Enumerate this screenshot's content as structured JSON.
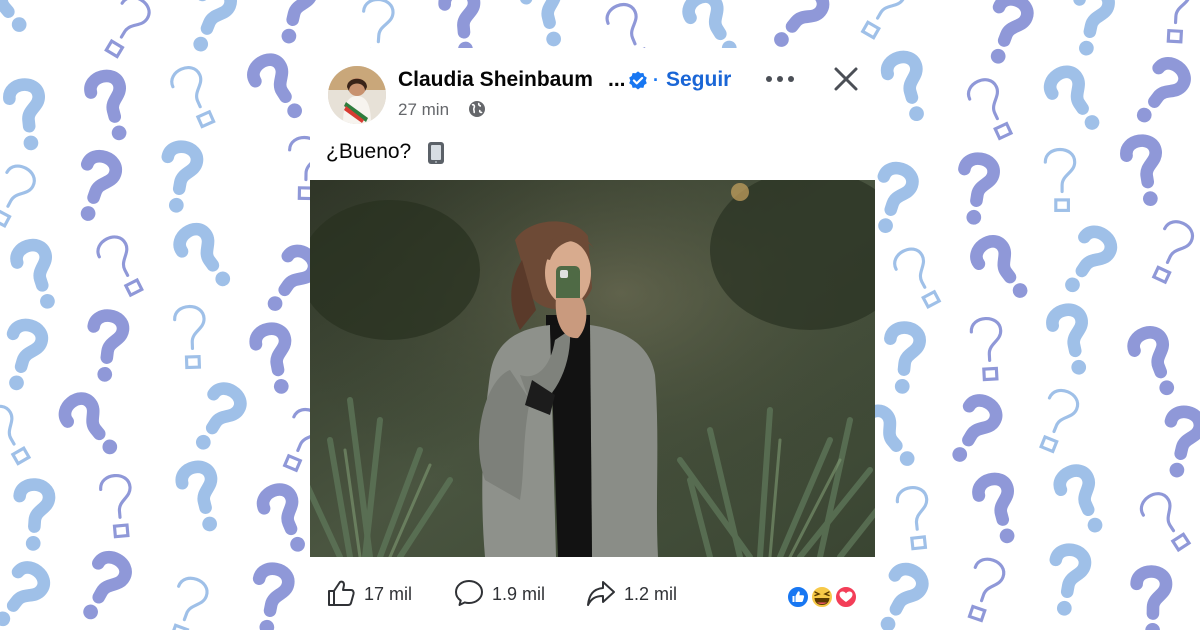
{
  "post": {
    "author_name": "Claudia Sheinbaum",
    "name_truncation": "...",
    "separator": "·",
    "follow_label": "Seguir",
    "time": "27 min",
    "caption": "¿Bueno?",
    "stats": {
      "likes": "17 mil",
      "comments": "1.9 mil",
      "shares": "1.2 mil"
    },
    "reactions": [
      "like-icon",
      "haha-icon",
      "love-icon"
    ]
  },
  "colors": {
    "brand_blue": "#1877f2",
    "follow_blue": "#1a66d6",
    "secondary_text": "#65676b",
    "pattern_blue": "#9fc0e8",
    "pattern_purple": "#8f98d8"
  },
  "icons": {
    "verified": "verified-badge-icon",
    "more": "more-options-icon",
    "close": "close-icon",
    "audience": "globe-icon",
    "caption_emoji": "mobile-phone-emoji-icon",
    "like": "thumbs-up-icon",
    "comment": "comment-bubble-icon",
    "share": "share-arrow-icon"
  }
}
